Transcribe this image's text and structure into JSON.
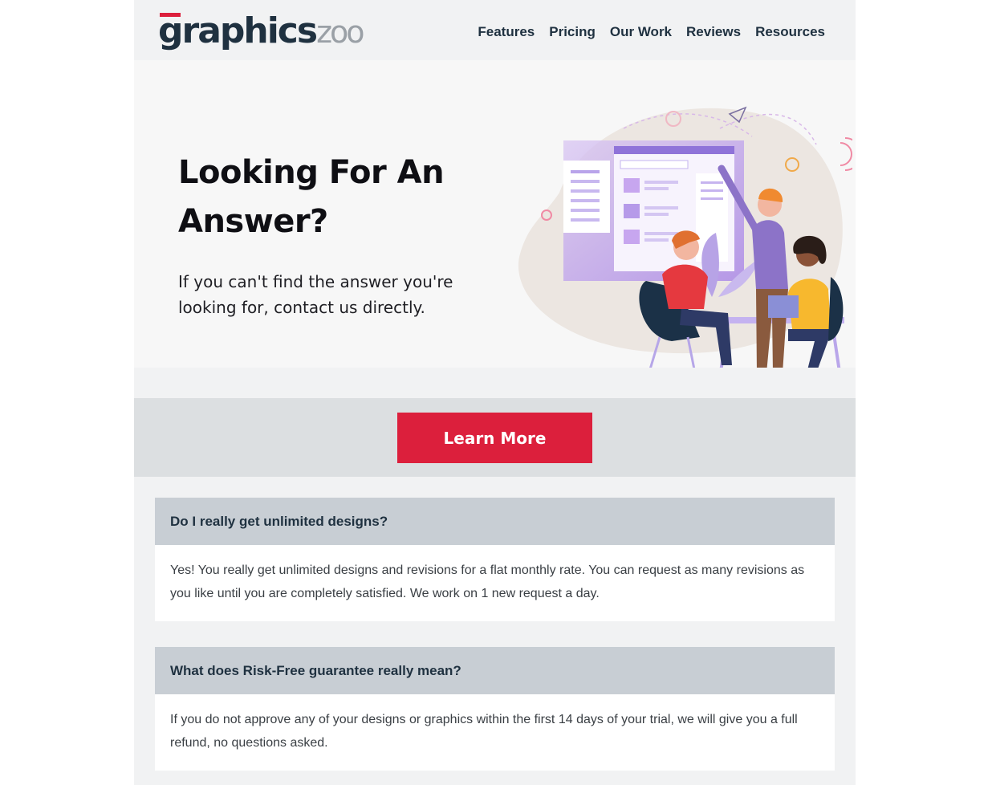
{
  "header": {
    "logo_main": "graphics",
    "logo_accent": "zoo",
    "nav": [
      "Features",
      "Pricing",
      "Our Work",
      "Reviews",
      "Resources"
    ]
  },
  "hero": {
    "title": "Looking For An Answer?",
    "subtitle": "If you can't find the answer you're looking for, contact us directly."
  },
  "cta": {
    "label": "Learn More"
  },
  "faq": [
    {
      "question": "Do I really get unlimited designs?",
      "answer": "Yes! You really get unlimited designs and revisions for a flat monthly rate. You can request as many revisions as you like until you are completely satisfied. We work on 1 new request a day."
    },
    {
      "question": "What does Risk-Free guarantee really mean?",
      "answer": "If you do not approve any of your designs or graphics within the first 14 days of your trial, we will give you a full refund, no questions asked."
    }
  ],
  "colors": {
    "brand_red": "#dc1f3c",
    "navy": "#1f3140",
    "faq_header_bg": "#c8ced4",
    "accent_purple": "#a37ee8"
  },
  "icons": [
    "team-collaboration-illustration"
  ]
}
